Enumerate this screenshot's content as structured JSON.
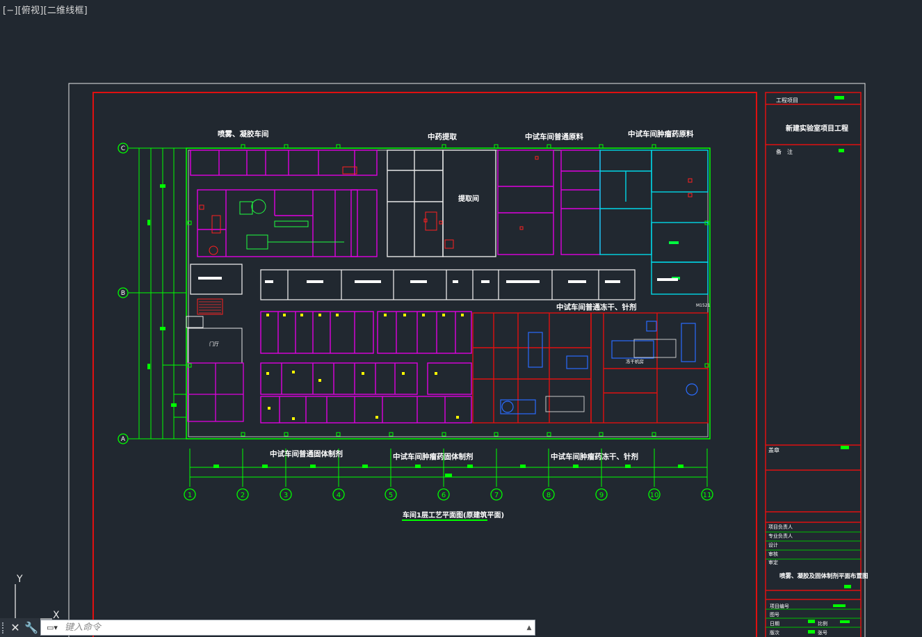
{
  "viewport_label": "[−][俯视][二维线框]",
  "colors": {
    "background": "#212830",
    "sheet_border": "#e8e8e8",
    "frame_red": "#e01010",
    "grid_green": "#00ff00",
    "wall_cyan": "#00d8e8",
    "wall_magenta": "#e000e0",
    "text_white": "#ffffff",
    "equipment_blue": "#2a6cff",
    "door_yellow": "#ffff00"
  },
  "drawing": {
    "zone_titles": {
      "spray": "喷雾、凝胶车间",
      "tcm_extract": "中药提取",
      "pilot_raw": "中试车间普通原料",
      "pilot_tumor_raw": "中试车间肿瘤药原料",
      "pilot_freeze": "中试车间普通冻干、针剂",
      "pilot_solid": "中试车间普通固体制剂",
      "pilot_tumor_solid": "中试车间肿瘤药固体制剂",
      "pilot_tumor_freeze": "中试车间肿瘤药冻干、针剂"
    },
    "room_labels": {
      "extraction": "提取间",
      "gate": "门厅",
      "freeze_dry": "冻干机房",
      "lyophilize_b": "冻干机房"
    },
    "drawing_caption": "车间1层工艺平面图(原建筑平面)",
    "column_axes": [
      "1",
      "2",
      "3",
      "4",
      "5",
      "6",
      "7",
      "8",
      "9",
      "10",
      "11"
    ],
    "row_axes": [
      "C",
      "B",
      "A"
    ],
    "door_tag": "M1521"
  },
  "title_block": {
    "project_label": "工程项目",
    "project_name": "新建实验室项目工程",
    "remarks_label": "备　注",
    "stamp_label": "盖章",
    "roles": [
      "项目负责人",
      "专业负责人",
      "设计",
      "审核",
      "审定"
    ],
    "drawing_name": "喷雾、凝胶及固体制剂平面布置图",
    "footer_rows": [
      "项目编号",
      "图号",
      "日期",
      "比例",
      "版次",
      "张号"
    ]
  },
  "ucs": {
    "y_label": "Y",
    "x_label": "X"
  },
  "command_line": {
    "placeholder": "键入命令",
    "close_icon": "close-icon",
    "wrench_icon": "wrench-icon",
    "prompt_icon": "terminal-icon"
  }
}
